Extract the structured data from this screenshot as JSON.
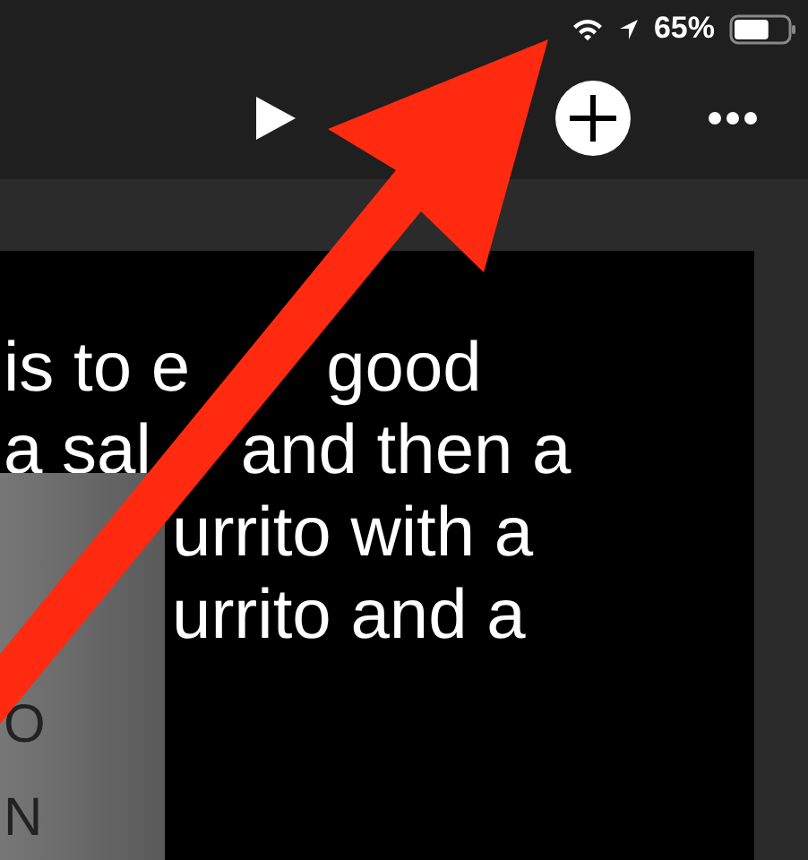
{
  "status_bar": {
    "battery": "65%"
  },
  "slide": {
    "lines": [
      [
        "is to e",
        "good"
      ],
      [
        "a sal",
        "and then a"
      ],
      [
        "urrito with a"
      ],
      [
        "urrito and a"
      ]
    ]
  },
  "side_panel": {
    "letters": [
      "O",
      "N"
    ]
  }
}
